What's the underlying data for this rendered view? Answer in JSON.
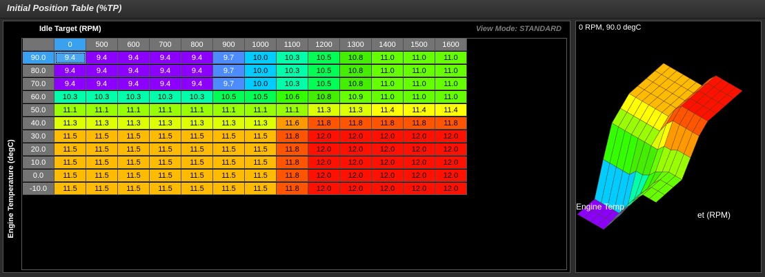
{
  "window": {
    "title": "Initial Position Table (%TP)"
  },
  "table": {
    "x_axis_label": "Idle Target (RPM)",
    "y_axis_label": "Engine Temperature (degC)",
    "view_mode": "View Mode: STANDARD",
    "columns": [
      "0",
      "500",
      "600",
      "700",
      "800",
      "900",
      "1000",
      "1100",
      "1200",
      "1300",
      "1400",
      "1500",
      "1600"
    ],
    "rows": [
      "90.0",
      "80.0",
      "70.0",
      "60.0",
      "50.0",
      "40.0",
      "30.0",
      "20.0",
      "10.0",
      "0.0",
      "-10.0"
    ],
    "values": [
      [
        "9.4",
        "9.4",
        "9.4",
        "9.4",
        "9.4",
        "9.7",
        "10.0",
        "10.3",
        "10.5",
        "10.8",
        "11.0",
        "11.0",
        "11.0"
      ],
      [
        "9.4",
        "9.4",
        "9.4",
        "9.4",
        "9.4",
        "9.7",
        "10.0",
        "10.3",
        "10.5",
        "10.8",
        "11.0",
        "11.0",
        "11.0"
      ],
      [
        "9.4",
        "9.4",
        "9.4",
        "9.4",
        "9.4",
        "9.7",
        "10.0",
        "10.3",
        "10.5",
        "10.8",
        "11.0",
        "11.0",
        "11.0"
      ],
      [
        "10.3",
        "10.3",
        "10.3",
        "10.3",
        "10.3",
        "10.5",
        "10.5",
        "10.6",
        "10.8",
        "10.9",
        "11.0",
        "11.0",
        "11.0"
      ],
      [
        "11.1",
        "11.1",
        "11.1",
        "11.1",
        "11.1",
        "11.1",
        "11.1",
        "11.1",
        "11.3",
        "11.3",
        "11.4",
        "11.4",
        "11.4"
      ],
      [
        "11.3",
        "11.3",
        "11.3",
        "11.3",
        "11.3",
        "11.3",
        "11.3",
        "11.6",
        "11.8",
        "11.8",
        "11.8",
        "11.8",
        "11.8"
      ],
      [
        "11.5",
        "11.5",
        "11.5",
        "11.5",
        "11.5",
        "11.5",
        "11.5",
        "11.8",
        "12.0",
        "12.0",
        "12.0",
        "12.0",
        "12.0"
      ],
      [
        "11.5",
        "11.5",
        "11.5",
        "11.5",
        "11.5",
        "11.5",
        "11.5",
        "11.8",
        "12.0",
        "12.0",
        "12.0",
        "12.0",
        "12.0"
      ],
      [
        "11.5",
        "11.5",
        "11.5",
        "11.5",
        "11.5",
        "11.5",
        "11.5",
        "11.8",
        "12.0",
        "12.0",
        "12.0",
        "12.0",
        "12.0"
      ],
      [
        "11.5",
        "11.5",
        "11.5",
        "11.5",
        "11.5",
        "11.5",
        "11.5",
        "11.8",
        "12.0",
        "12.0",
        "12.0",
        "12.0",
        "12.0"
      ],
      [
        "11.5",
        "11.5",
        "11.5",
        "11.5",
        "11.5",
        "11.5",
        "11.5",
        "11.8",
        "12.0",
        "12.0",
        "12.0",
        "12.0",
        "12.0"
      ]
    ],
    "selected": {
      "row": 0,
      "col": 0
    }
  },
  "surface": {
    "status": "0 RPM, 90.0 degC",
    "axis_label_temp": "Engine Temp",
    "axis_label_rpm": "et (RPM)"
  },
  "colors": {
    "value_map": {
      "9.4": "#8b00ff",
      "9.7": "#4d8cff",
      "10.0": "#00ccff",
      "10.3": "#00ffaa",
      "10.5": "#00ff55",
      "10.6": "#33ff00",
      "10.8": "#44ee00",
      "10.9": "#66ff00",
      "11.0": "#66ff00",
      "11.1": "#99ff00",
      "11.3": "#ddff00",
      "11.4": "#ffff00",
      "11.5": "#ffbb00",
      "11.6": "#ff9900",
      "11.8": "#ff5500",
      "12.0": "#ff1100"
    },
    "dark_text_values": [
      "9.7"
    ]
  }
}
